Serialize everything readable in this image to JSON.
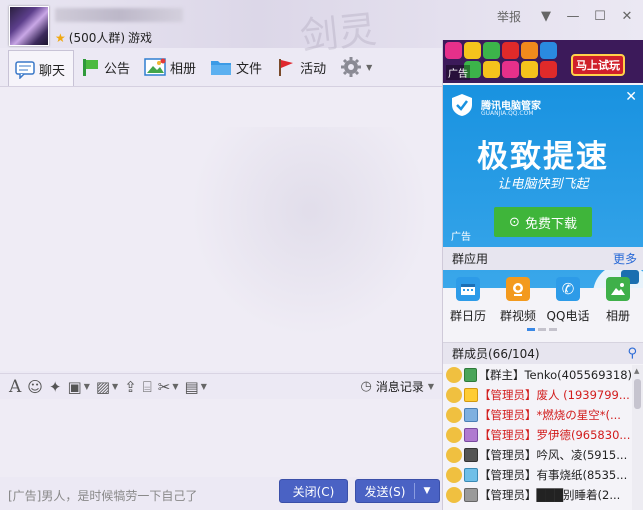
{
  "header": {
    "member_count": "(500人群)",
    "category": "游戏",
    "report_label": "举报",
    "watermark": "剑灵"
  },
  "tabs": [
    {
      "label": "聊天",
      "icon": "chat-icon"
    },
    {
      "label": "公告",
      "icon": "announcement-icon"
    },
    {
      "label": "相册",
      "icon": "album-icon"
    },
    {
      "label": "文件",
      "icon": "folder-icon"
    },
    {
      "label": "活动",
      "icon": "flag-icon"
    }
  ],
  "input_toolbar": {
    "history_label": "消息记录"
  },
  "bottom": {
    "ad_text": "[广告]男人，是时候犒劳一下自己了",
    "close_label": "关闭(C)",
    "send_label": "发送(S)"
  },
  "ads": {
    "top_label": "广告",
    "top_try": "马上试玩",
    "brand": "腾讯电脑管家",
    "brand_url": "GUANJIA.QQ.COM",
    "headline": "极致提速",
    "sub": "让电脑快到飞起",
    "download": "免费下载",
    "main_label": "广告",
    "colors": {
      "ad_blue": "#1992e0",
      "download_green": "#3fb53a"
    }
  },
  "apps": {
    "title": "群应用",
    "more": "更多",
    "items": [
      {
        "label": "群日历",
        "icon": "calendar-icon",
        "color": "#2d9be8"
      },
      {
        "label": "群视频",
        "icon": "video-icon",
        "color": "#f39a1e"
      },
      {
        "label": "QQ电话",
        "icon": "phone-icon",
        "color": "#2d9be8"
      },
      {
        "label": "相册",
        "icon": "album-icon",
        "color": "#3fb04a"
      }
    ]
  },
  "members": {
    "title": "群成员(66/104)",
    "list": [
      {
        "role": "【群主】",
        "name": "Tenko(405569318)",
        "admin": false
      },
      {
        "role": "【管理员】",
        "name": "废人 (1939799...",
        "admin": true
      },
      {
        "role": "【管理员】",
        "name": "*燃烧の星空*(...",
        "admin": true
      },
      {
        "role": "【管理员】",
        "name": "罗伊德(965830...",
        "admin": true
      },
      {
        "role": "【管理员】",
        "name": "吟风、凌(5915...",
        "admin": false
      },
      {
        "role": "【管理员】",
        "name": "有事烧纸(8535...",
        "admin": false
      },
      {
        "role": "【管理员】",
        "name": "███别睡着(2...",
        "admin": false
      }
    ]
  }
}
